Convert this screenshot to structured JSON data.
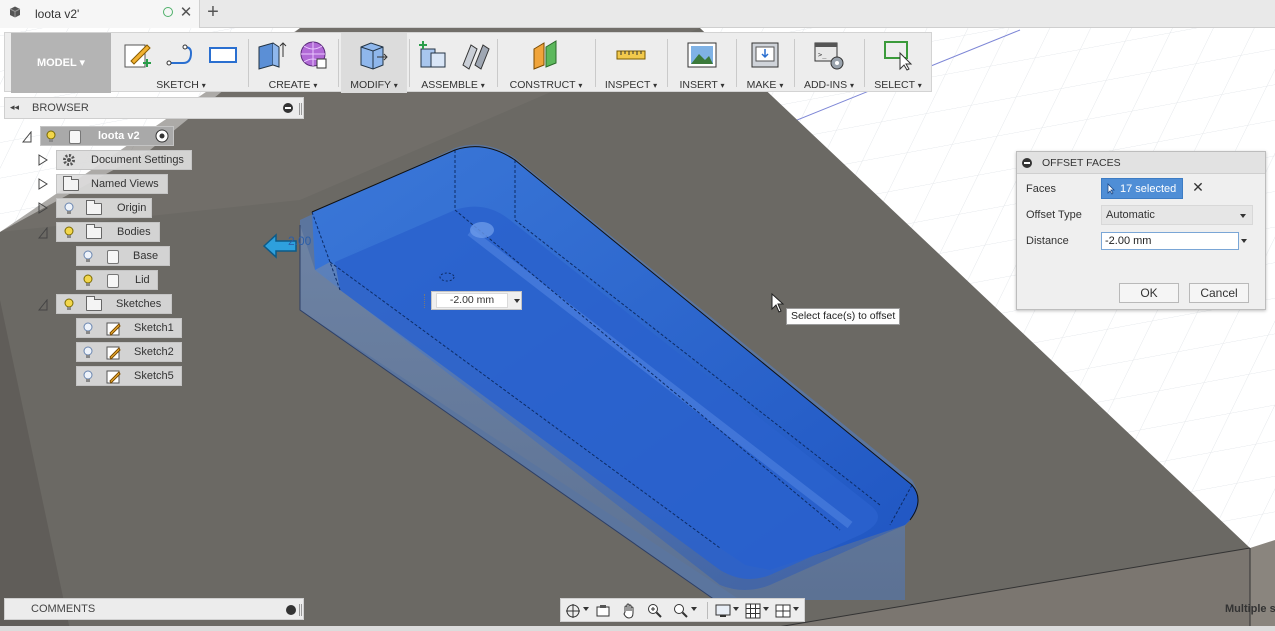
{
  "tab": {
    "title": "loota v2'",
    "close": "✕",
    "new": "+"
  },
  "toolbar": {
    "model": "MODEL ▾",
    "groups": [
      {
        "label": "SKETCH"
      },
      {
        "label": "CREATE"
      },
      {
        "label": "MODIFY"
      },
      {
        "label": "ASSEMBLE"
      },
      {
        "label": "CONSTRUCT"
      },
      {
        "label": "INSPECT"
      },
      {
        "label": "INSERT"
      },
      {
        "label": "MAKE"
      },
      {
        "label": "ADD-INS"
      },
      {
        "label": "SELECT"
      }
    ],
    "caret": "▾"
  },
  "browser": {
    "title": "BROWSER",
    "collapse": "◂◂",
    "root": "loota v2",
    "document_settings": "Document Settings",
    "named_views": "Named Views",
    "origin": "Origin",
    "bodies": "Bodies",
    "body_base": "Base",
    "body_lid": "Lid",
    "sketches": "Sketches",
    "sketch1": "Sketch1",
    "sketch2": "Sketch2",
    "sketch5": "Sketch5"
  },
  "comments": {
    "title": "COMMENTS"
  },
  "dialog": {
    "title": "OFFSET FACES",
    "faces_label": "Faces",
    "faces_value": "17 selected",
    "clear": "✕",
    "offset_type_label": "Offset Type",
    "offset_type_value": "Automatic",
    "distance_label": "Distance",
    "distance_value": "-2.00 mm",
    "ok": "OK",
    "cancel": "Cancel"
  },
  "canvas": {
    "manipulator_value": "-2.00 mm",
    "arrow_label": "2.00",
    "tooltip": "Select face(s) to offset"
  },
  "status": {
    "multiple_selection": "Multiple s"
  },
  "colors": {
    "selection_blue": "#2d63c8",
    "body_dark": "#5f5c57",
    "faces_button": "#4f8ed6"
  }
}
